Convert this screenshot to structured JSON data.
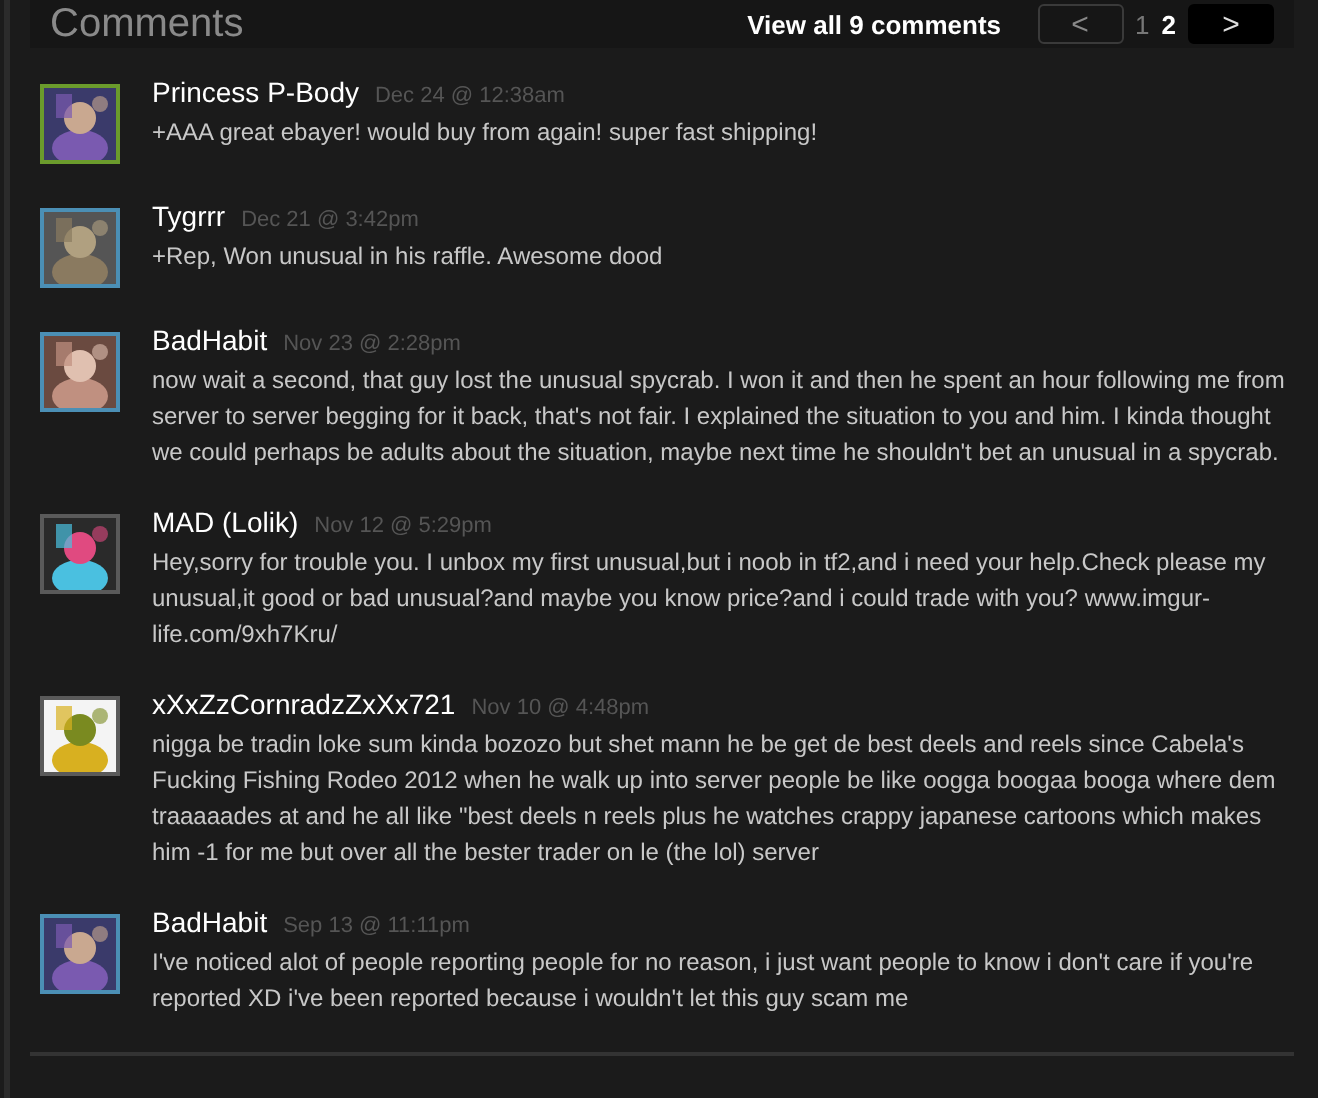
{
  "header": {
    "title": "Comments",
    "view_all": "View all 9 comments",
    "prev": "<",
    "pages": [
      {
        "label": "1",
        "selected": false
      },
      {
        "label": "2",
        "selected": true
      }
    ],
    "next": ">"
  },
  "comments": [
    {
      "author": "Princess P-Body",
      "date": "Dec 24 @ 12:38am",
      "text": "+AAA great ebayer! would buy from again! super fast shipping!",
      "color": "#6b9b2c"
    },
    {
      "author": "Tygrrr",
      "date": "Dec 21 @ 3:42pm",
      "text": "+Rep, Won unusual in his raffle. Awesome dood",
      "color": "#4b8fb5"
    },
    {
      "author": "BadHabit",
      "date": "Nov 23 @ 2:28pm",
      "text": "now wait a second, that guy lost the unusual spycrab. I won it and then he spent an hour following me from server to server begging for it back, that's not fair. I explained the situation to you and him. I kinda thought we could perhaps be adults about the situation, maybe next time he shouldn't bet an unusual in a spycrab.",
      "color": "#4b8fb5"
    },
    {
      "author": "MAD (Lolik)",
      "date": "Nov 12 @ 5:29pm",
      "text": "Hey,sorry for trouble you. I unbox my first unusual,but i noob in tf2,and i need your help.Check please my unusual,it good or bad unusual?and maybe you know price?and i could trade with you? www.imgur-life.com/9xh7Kru/",
      "color": "#5a5a5a"
    },
    {
      "author": "xXxZzCornradzZxXx721",
      "date": "Nov 10 @ 4:48pm",
      "text": "nigga be tradin loke sum kinda bozozo but shet mann he be get de best deels and reels since Cabela's Fucking Fishing Rodeo 2012 when he walk up into server people be like oogga boogaa booga where dem traaaaades at and he all like \"best deels n reels plus he watches crappy japanese cartoons which makes him -1 for me but over all the bester trader on le (the lol) server",
      "color": "#5a5a5a"
    },
    {
      "author": "BadHabit",
      "date": "Sep 13 @ 11:11pm",
      "text": "I've noticed alot of people reporting people for no reason, i just want people to know i don't care if you're reported XD i've been reported because i wouldn't let this guy scam me",
      "color": "#4b8fb5"
    }
  ]
}
